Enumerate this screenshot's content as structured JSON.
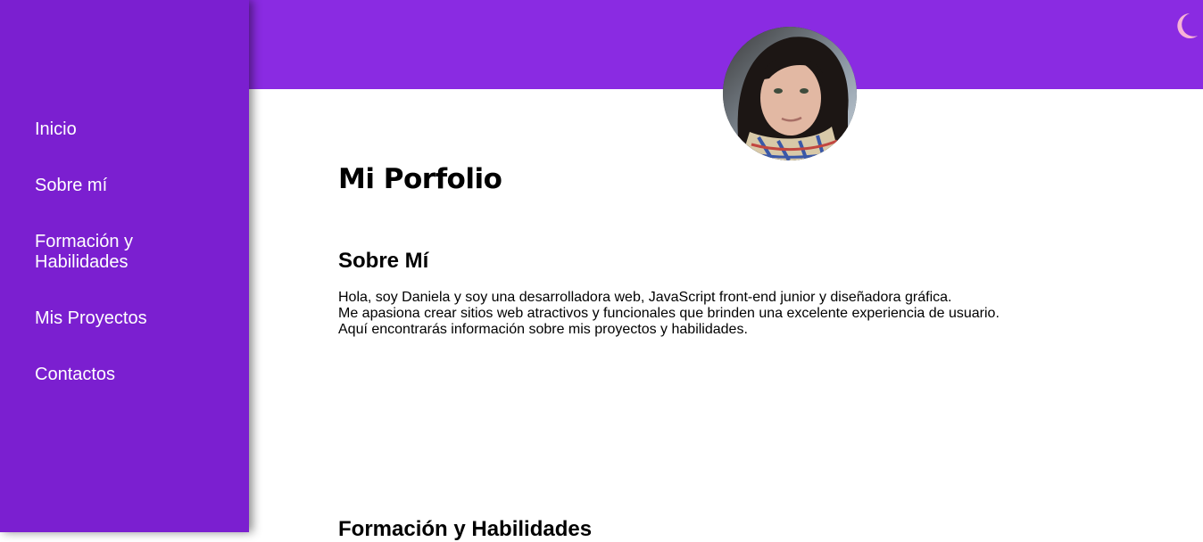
{
  "sidebar": {
    "items": [
      {
        "label": "Inicio"
      },
      {
        "label": "Sobre mí"
      },
      {
        "label": "Formación y Habilidades"
      },
      {
        "label": "Mis Proyectos"
      },
      {
        "label": "Contactos"
      }
    ]
  },
  "header": {
    "theme_toggle_icon": "moon-icon"
  },
  "main": {
    "title": "Mi Porfolio",
    "about": {
      "heading": "Sobre Mí",
      "lines": [
        "Hola, soy Daniela y soy una desarrolladora web, JavaScript front-end junior y diseñadora gráfica.",
        "Me apasiona crear sitios web atractivos y funcionales que brinden una excelente experiencia de usuario.",
        "Aquí encontrarás información sobre mis proyectos y habilidades."
      ]
    },
    "training": {
      "heading": "Formación y Habilidades"
    }
  },
  "colors": {
    "sidebar": "#7b1fd0",
    "header": "#8a2be2",
    "moon": "#f7b3d6",
    "text": "#000000"
  }
}
